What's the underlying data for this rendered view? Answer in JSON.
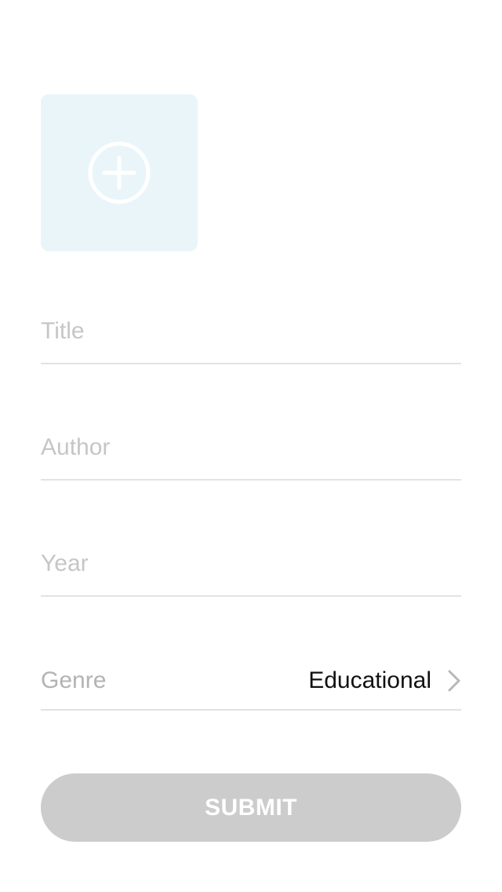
{
  "photo": {
    "icon": "plus-circle-icon"
  },
  "form": {
    "title_placeholder": "Title",
    "author_placeholder": "Author",
    "year_placeholder": "Year",
    "genre_label": "Genre",
    "genre_value": "Educational",
    "submit_label": "SUBMIT"
  },
  "colors": {
    "photo_bg": "#eaf5fa",
    "button_bg": "#cccccc",
    "placeholder": "#c6c6c6",
    "divider": "#e3e3e3"
  }
}
